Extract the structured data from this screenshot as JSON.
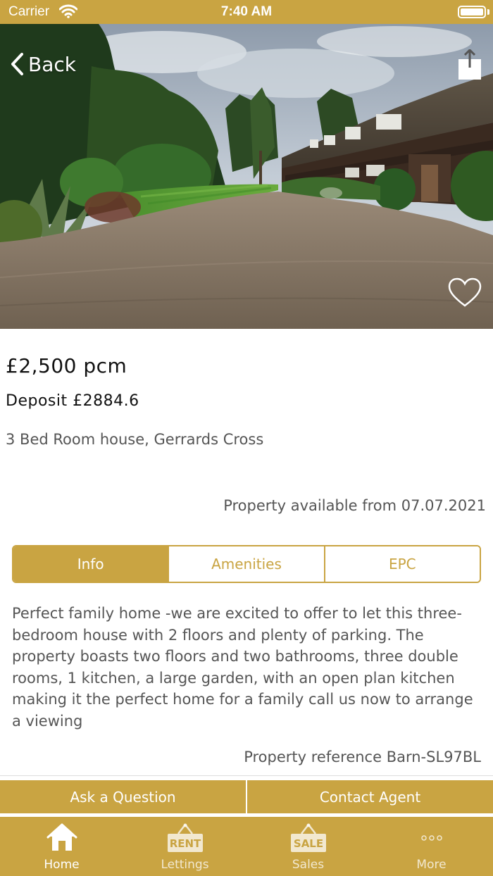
{
  "status_bar": {
    "carrier": "Carrier",
    "time": "7:40 AM",
    "icons": [
      "wifi-icon",
      "battery-icon"
    ]
  },
  "hero": {
    "back_label": "Back",
    "icons": [
      "back-chevron-icon",
      "share-icon",
      "heart-icon"
    ]
  },
  "listing": {
    "price": "£2,500 pcm",
    "deposit": "Deposit £2884.6",
    "summary": "3 Bed Room house, Gerrards Cross",
    "available": "Property available from 07.07.2021"
  },
  "tabs": [
    {
      "label": "Info",
      "active": true
    },
    {
      "label": "Amenities",
      "active": false
    },
    {
      "label": "EPC",
      "active": false
    }
  ],
  "description": "Perfect family home -we are excited to offer to let this three-bedroom house with 2 floors and plenty of parking. The property boasts two floors and two bathrooms, three double rooms, 1 kitchen, a large garden, with an open plan kitchen making it the perfect home for a family call us now to arrange a viewing",
  "reference": "Property reference Barn-SL97BL",
  "actions": {
    "ask_label": "Ask a Question",
    "contact_label": "Contact Agent"
  },
  "tabbar": [
    {
      "label": "Home",
      "icon": "home-icon",
      "active": true
    },
    {
      "label": "Lettings",
      "icon": "rent-sign-icon",
      "sign_text": "RENT",
      "active": false
    },
    {
      "label": "Sales",
      "icon": "sale-sign-icon",
      "sign_text": "SALE",
      "active": false
    },
    {
      "label": "More",
      "icon": "more-dots-icon",
      "active": false
    }
  ],
  "colors": {
    "brand": "#c9a442",
    "text_dark": "#111111",
    "text_muted": "#555555"
  }
}
